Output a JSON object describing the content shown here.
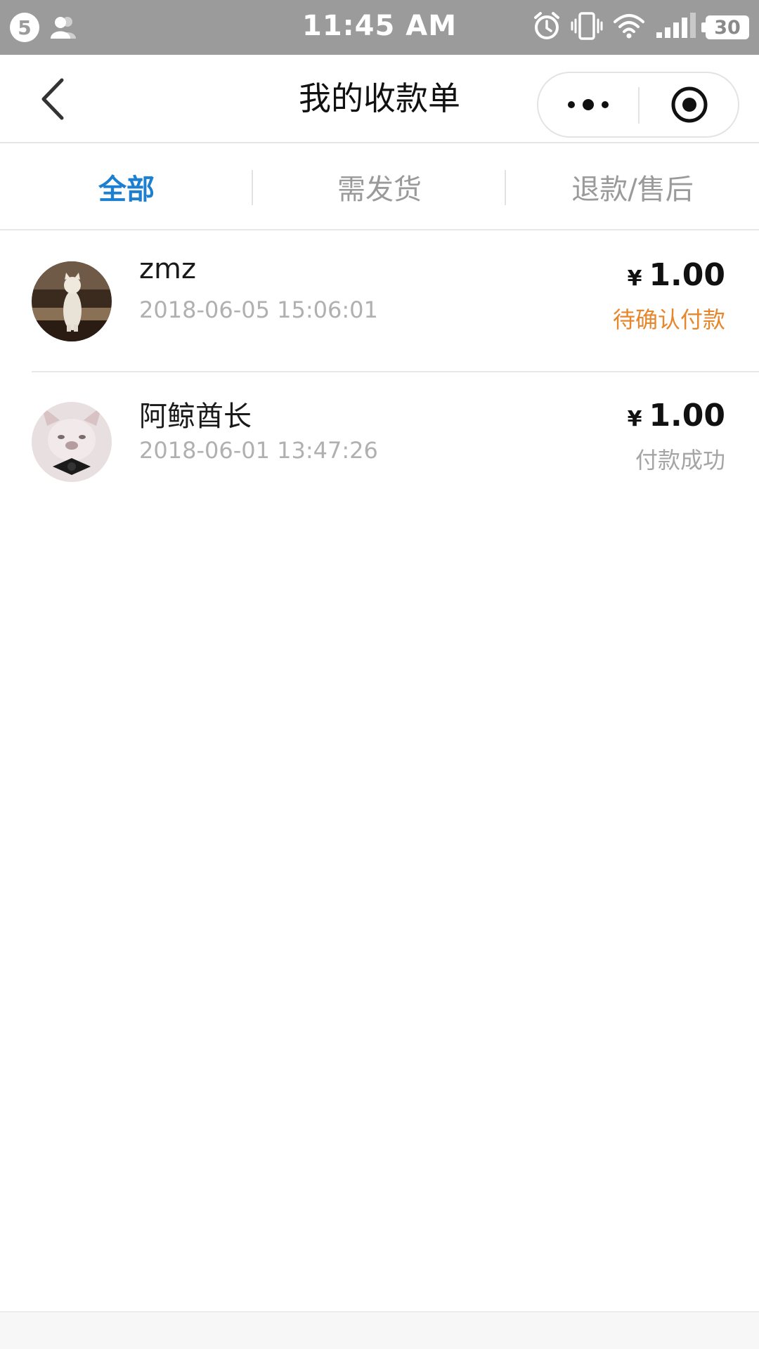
{
  "status_bar": {
    "notification_count": "5",
    "time": "11:45 AM",
    "battery": "30",
    "icons": [
      "contacts-icon",
      "alarm-icon",
      "vibrate-icon",
      "wifi-icon",
      "signal-icon",
      "battery-icon"
    ]
  },
  "nav": {
    "title": "我的收款单",
    "icons": [
      "back-arrow-icon",
      "more-dots-icon",
      "close-target-icon"
    ]
  },
  "tabs": [
    {
      "label": "全部",
      "active": true
    },
    {
      "label": "需发货",
      "active": false
    },
    {
      "label": "退款/售后",
      "active": false
    }
  ],
  "orders": [
    {
      "buyer": "zmz",
      "time": "2018-06-05 15:06:01",
      "currency": "¥",
      "amount": "1.00",
      "status": "待确认付款",
      "avatar": "cat-avatar"
    },
    {
      "buyer": "阿鲸酋长",
      "time": "2018-06-01 13:47:26",
      "currency": "¥",
      "amount": "1.00",
      "status": "付款成功",
      "avatar": "dog-avatar"
    }
  ],
  "colors": {
    "status_bar": "#9b9b9b",
    "active_tab": "#1d7fd0",
    "pending_status": "#e8862c",
    "muted_text": "#a5a5a5"
  }
}
